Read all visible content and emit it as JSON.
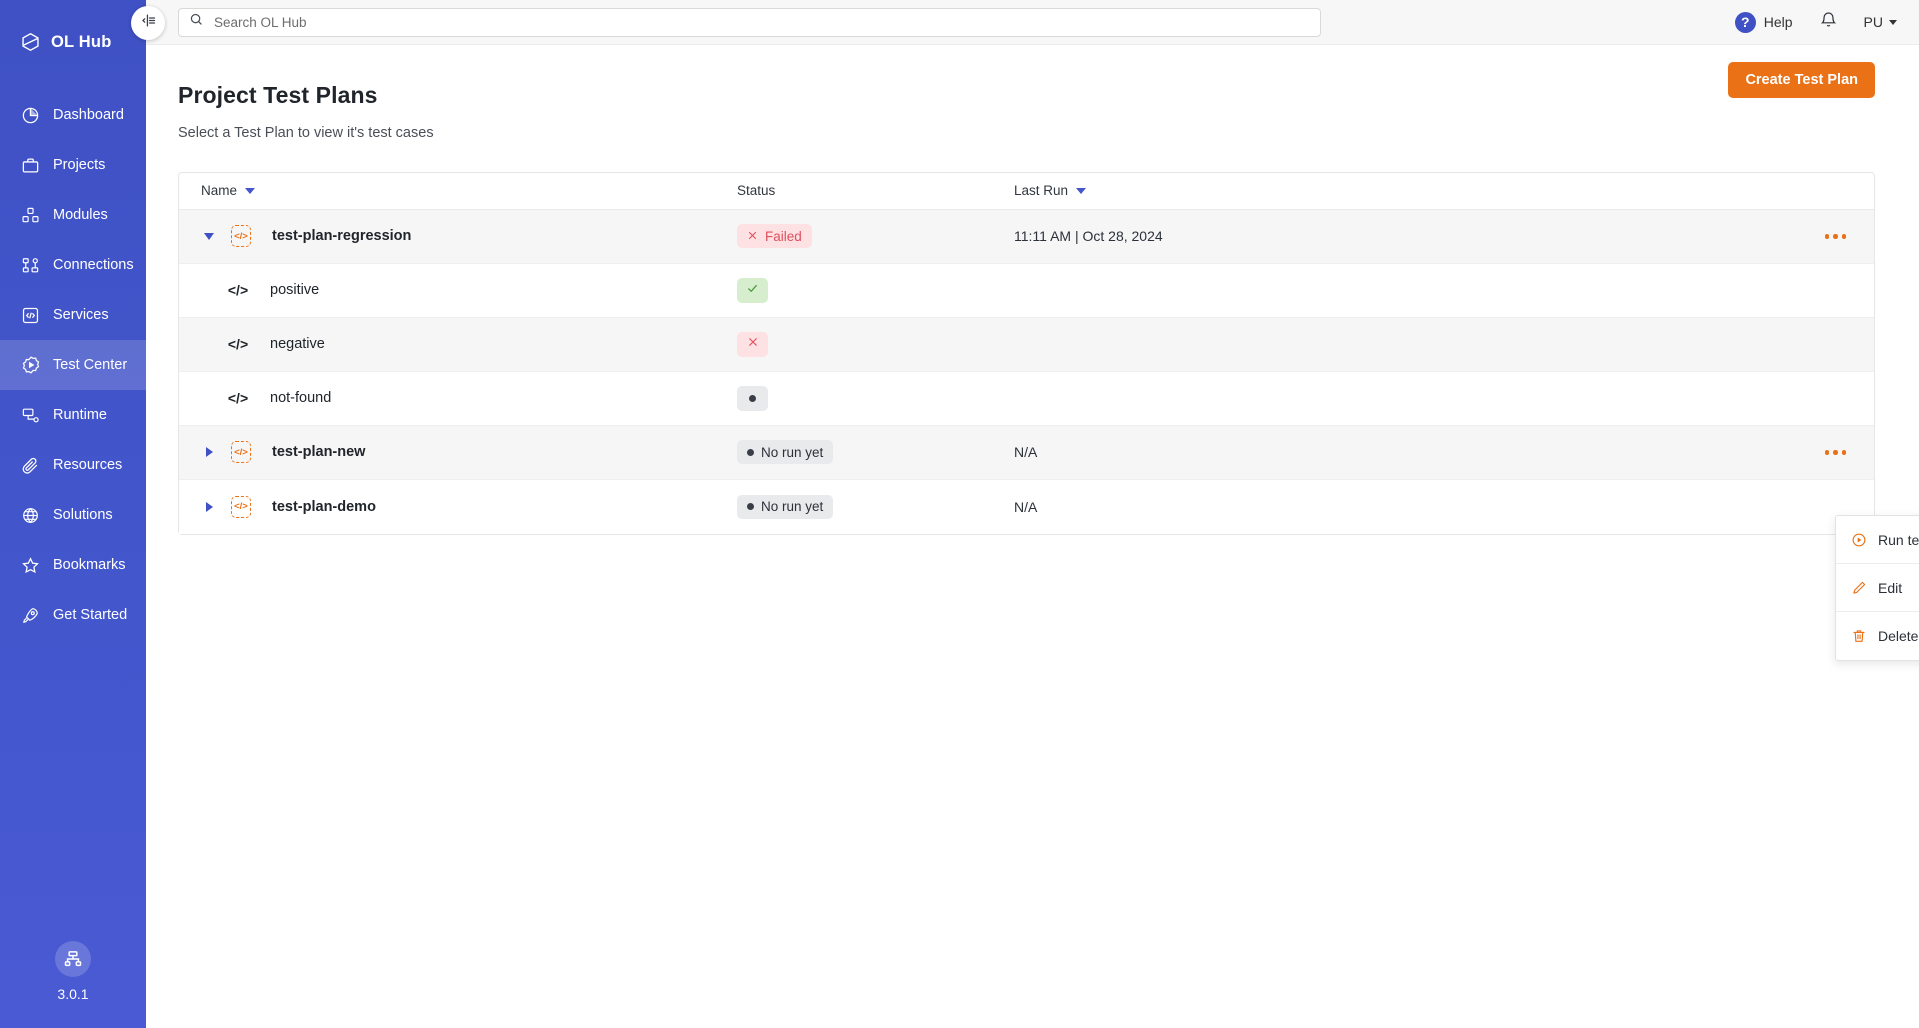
{
  "sidebar": {
    "brand": "OL Hub",
    "brand_icon": "hexagon-logo-icon",
    "items": [
      {
        "label": "Dashboard",
        "icon": "pie-chart-icon",
        "active": false
      },
      {
        "label": "Projects",
        "icon": "briefcase-icon",
        "active": false
      },
      {
        "label": "Modules",
        "icon": "cubes-icon",
        "active": false
      },
      {
        "label": "Connections",
        "icon": "network-icon",
        "active": false
      },
      {
        "label": "Services",
        "icon": "code-box-icon",
        "active": false
      },
      {
        "label": "Test Center",
        "icon": "gear-play-icon",
        "active": true
      },
      {
        "label": "Runtime",
        "icon": "server-node-icon",
        "active": false
      },
      {
        "label": "Resources",
        "icon": "paperclip-icon",
        "active": false
      },
      {
        "label": "Solutions",
        "icon": "globe-grid-icon",
        "active": false
      },
      {
        "label": "Bookmarks",
        "icon": "star-icon",
        "active": false
      },
      {
        "label": "Get Started",
        "icon": "rocket-icon",
        "active": false
      }
    ],
    "bottom_badge_icon": "sitemap-icon",
    "version": "3.0.1",
    "collapse_icon": "collapse-panel-icon"
  },
  "topbar": {
    "search_placeholder": "Search OL Hub",
    "search_value": "",
    "search_icon": "search-icon",
    "help_label": "Help",
    "help_icon": "question-mark-icon",
    "notifications_icon": "bell-icon",
    "user_initials": "PU",
    "user_caret_icon": "chevron-down-icon"
  },
  "page": {
    "title": "Project Test Plans",
    "subtitle": "Select a Test Plan to view it's test cases",
    "create_button": "Create Test Plan",
    "accent_color": "#eb7116",
    "brand_color": "#3f51c4"
  },
  "table": {
    "columns": [
      {
        "label": "Name",
        "sortable": true
      },
      {
        "label": "Status",
        "sortable": false
      },
      {
        "label": "Last Run",
        "sortable": true
      }
    ],
    "rows": [
      {
        "type": "plan",
        "name": "test-plan-regression",
        "expanded": true,
        "shaded": true,
        "status_kind": "chip",
        "status_label": "Failed",
        "status_variant": "failed",
        "last_run": "11:11 AM | Oct 28, 2024",
        "has_actions": true
      },
      {
        "type": "case",
        "name": "positive",
        "shaded": false,
        "status_kind": "square",
        "status_label": "",
        "status_variant": "pass",
        "last_run": "",
        "has_actions": false
      },
      {
        "type": "case",
        "name": "negative",
        "shaded": true,
        "status_kind": "square",
        "status_label": "",
        "status_variant": "fail",
        "last_run": "",
        "has_actions": false
      },
      {
        "type": "case",
        "name": "not-found",
        "shaded": false,
        "status_kind": "square",
        "status_label": "",
        "status_variant": "none",
        "last_run": "",
        "has_actions": false
      },
      {
        "type": "plan",
        "name": "test-plan-new",
        "expanded": false,
        "shaded": true,
        "status_kind": "chip",
        "status_label": "No run yet",
        "status_variant": "norun",
        "last_run": "N/A",
        "has_actions": true
      },
      {
        "type": "plan",
        "name": "test-plan-demo",
        "expanded": false,
        "shaded": false,
        "status_kind": "chip",
        "status_label": "No run yet",
        "status_variant": "norun",
        "last_run": "N/A",
        "has_actions": true
      }
    ]
  },
  "context_menu": {
    "visible": true,
    "items": [
      {
        "label": "Run test",
        "icon": "play-circle-icon"
      },
      {
        "label": "Edit",
        "icon": "pencil-icon"
      },
      {
        "label": "Delete",
        "icon": "trash-icon"
      }
    ]
  }
}
